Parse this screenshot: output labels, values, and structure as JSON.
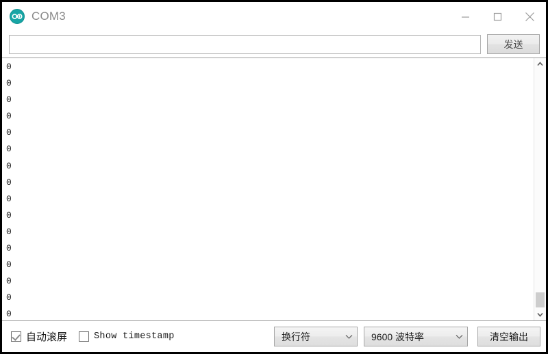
{
  "window": {
    "title": "COM3",
    "logo_icon": "arduino-logo-icon",
    "accent_color": "#17a5a5",
    "controls": {
      "minimize_icon": "minimize-icon",
      "maximize_icon": "maximize-icon",
      "close_icon": "close-icon"
    }
  },
  "send_row": {
    "input_value": "",
    "input_placeholder": "",
    "send_label": "发送"
  },
  "output": {
    "lines": [
      "0",
      "0",
      "0",
      "0",
      "0",
      "0",
      "0",
      "0",
      "0",
      "0",
      "0",
      "0",
      "0",
      "0",
      "0",
      "0"
    ],
    "scrollbar": {
      "up_arrow_icon": "chevron-up-icon",
      "down_arrow_icon": "chevron-down-icon",
      "thumb_position": "bottom"
    }
  },
  "statusbar": {
    "autoscroll": {
      "label": "自动滚屏",
      "checked": true
    },
    "show_timestamp": {
      "label": "Show timestamp",
      "checked": false
    },
    "line_ending": {
      "value": "换行符",
      "arrow_icon": "chevron-down-icon"
    },
    "baud_rate": {
      "value": "9600 波特率",
      "arrow_icon": "chevron-down-icon"
    },
    "clear_output_label": "清空输出"
  }
}
